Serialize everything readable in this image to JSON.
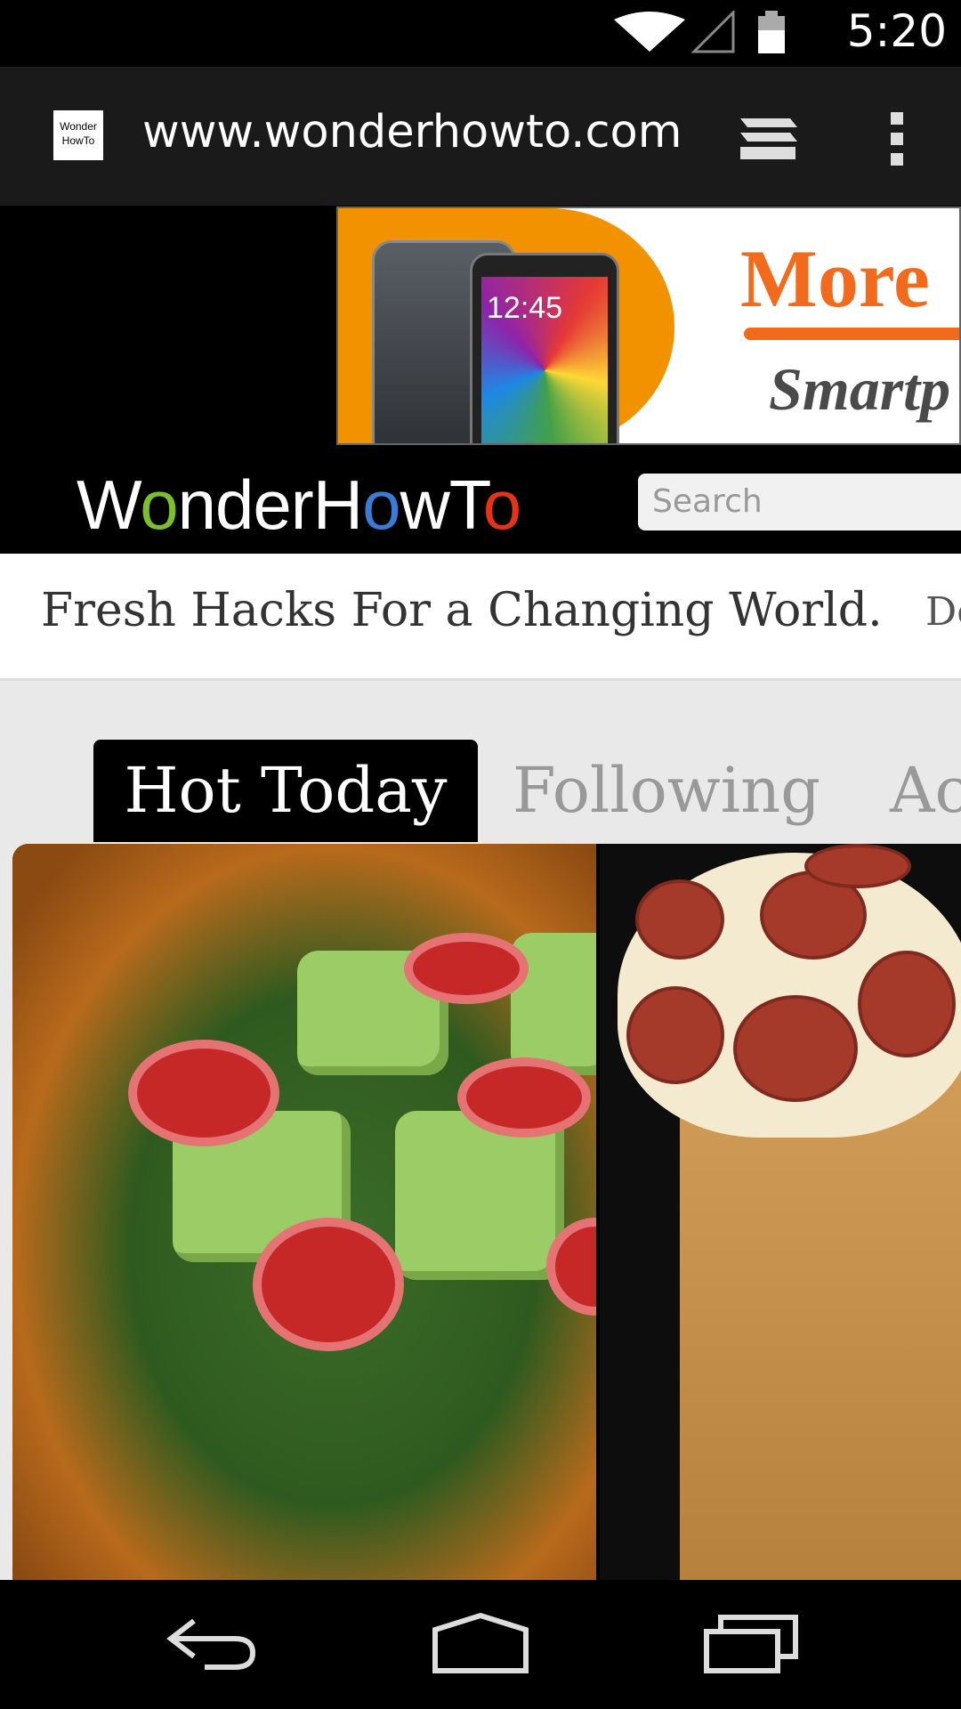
{
  "status_bar": {
    "time": "5:20",
    "icons": [
      "wifi-icon",
      "signal-icon",
      "battery-icon"
    ]
  },
  "browser": {
    "favicon_text_line1": "Wonder",
    "favicon_text_line2": "HowTo",
    "url": "www.wonderhowto.com",
    "icons": [
      "tabs-icon",
      "overflow-menu-icon"
    ]
  },
  "ad": {
    "headline": "More",
    "subline": "Smartp",
    "phone_time": "12:45"
  },
  "site": {
    "logo_parts": [
      "W",
      "o",
      "nderH",
      "o",
      "wT",
      "o"
    ],
    "search_placeholder": "Search",
    "tagline": "Fresh Hacks For a Changing World.",
    "tagline_next": "De"
  },
  "tabs": {
    "active": "Hot Today",
    "second": "Following",
    "third": "Ac"
  },
  "nav": {
    "icons": [
      "back-icon",
      "home-icon",
      "recents-icon"
    ]
  },
  "colors": {
    "logo_green": "#7cbf2c",
    "logo_blue": "#3a7bd5",
    "logo_red": "#e53318",
    "ad_orange": "#f39200"
  }
}
